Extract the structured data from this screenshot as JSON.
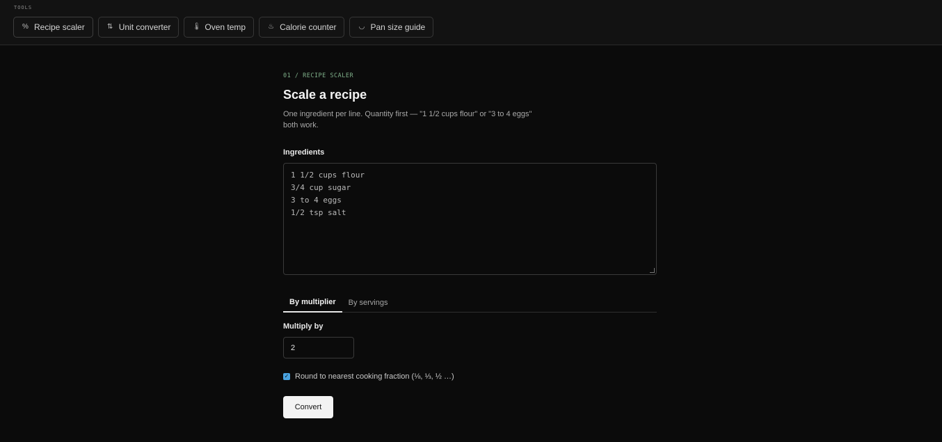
{
  "header": {
    "section_label": "TOOLS",
    "tools": [
      {
        "label": "Recipe scaler",
        "icon": "percent-icon",
        "glyph": "%"
      },
      {
        "label": "Unit converter",
        "icon": "swap-arrows-icon",
        "glyph": "⇅"
      },
      {
        "label": "Oven temp",
        "icon": "thermometer-icon",
        "glyph": "🌡"
      },
      {
        "label": "Calorie counter",
        "icon": "flame-icon",
        "glyph": "♨"
      },
      {
        "label": "Pan size guide",
        "icon": "pan-icon",
        "glyph": "◡"
      }
    ]
  },
  "main": {
    "eyebrow": "01 / RECIPE SCALER",
    "title": "Scale a recipe",
    "description": "One ingredient per line. Quantity first — \"1 1/2 cups flour\" or \"3 to 4 eggs\" both work.",
    "ingredients_label": "Ingredients",
    "ingredients": [
      "1 1/2 cups flour",
      "3/4 cup sugar",
      "3 to 4 eggs",
      "1/2 tsp salt"
    ],
    "tabs": [
      {
        "label": "By multiplier",
        "active": true
      },
      {
        "label": "By servings",
        "active": false
      }
    ],
    "multiply_label": "Multiply by",
    "multiply_value": "2",
    "round_checked": true,
    "round_label": "Round to nearest cooking fraction (⅛, ⅓, ½ …)",
    "convert_label": "Convert"
  },
  "colors": {
    "background": "#0b0b0b",
    "accent_eyebrow": "#7fb08a",
    "checkbox": "#4aa3e0",
    "primary_button": "#f3f3f3"
  }
}
